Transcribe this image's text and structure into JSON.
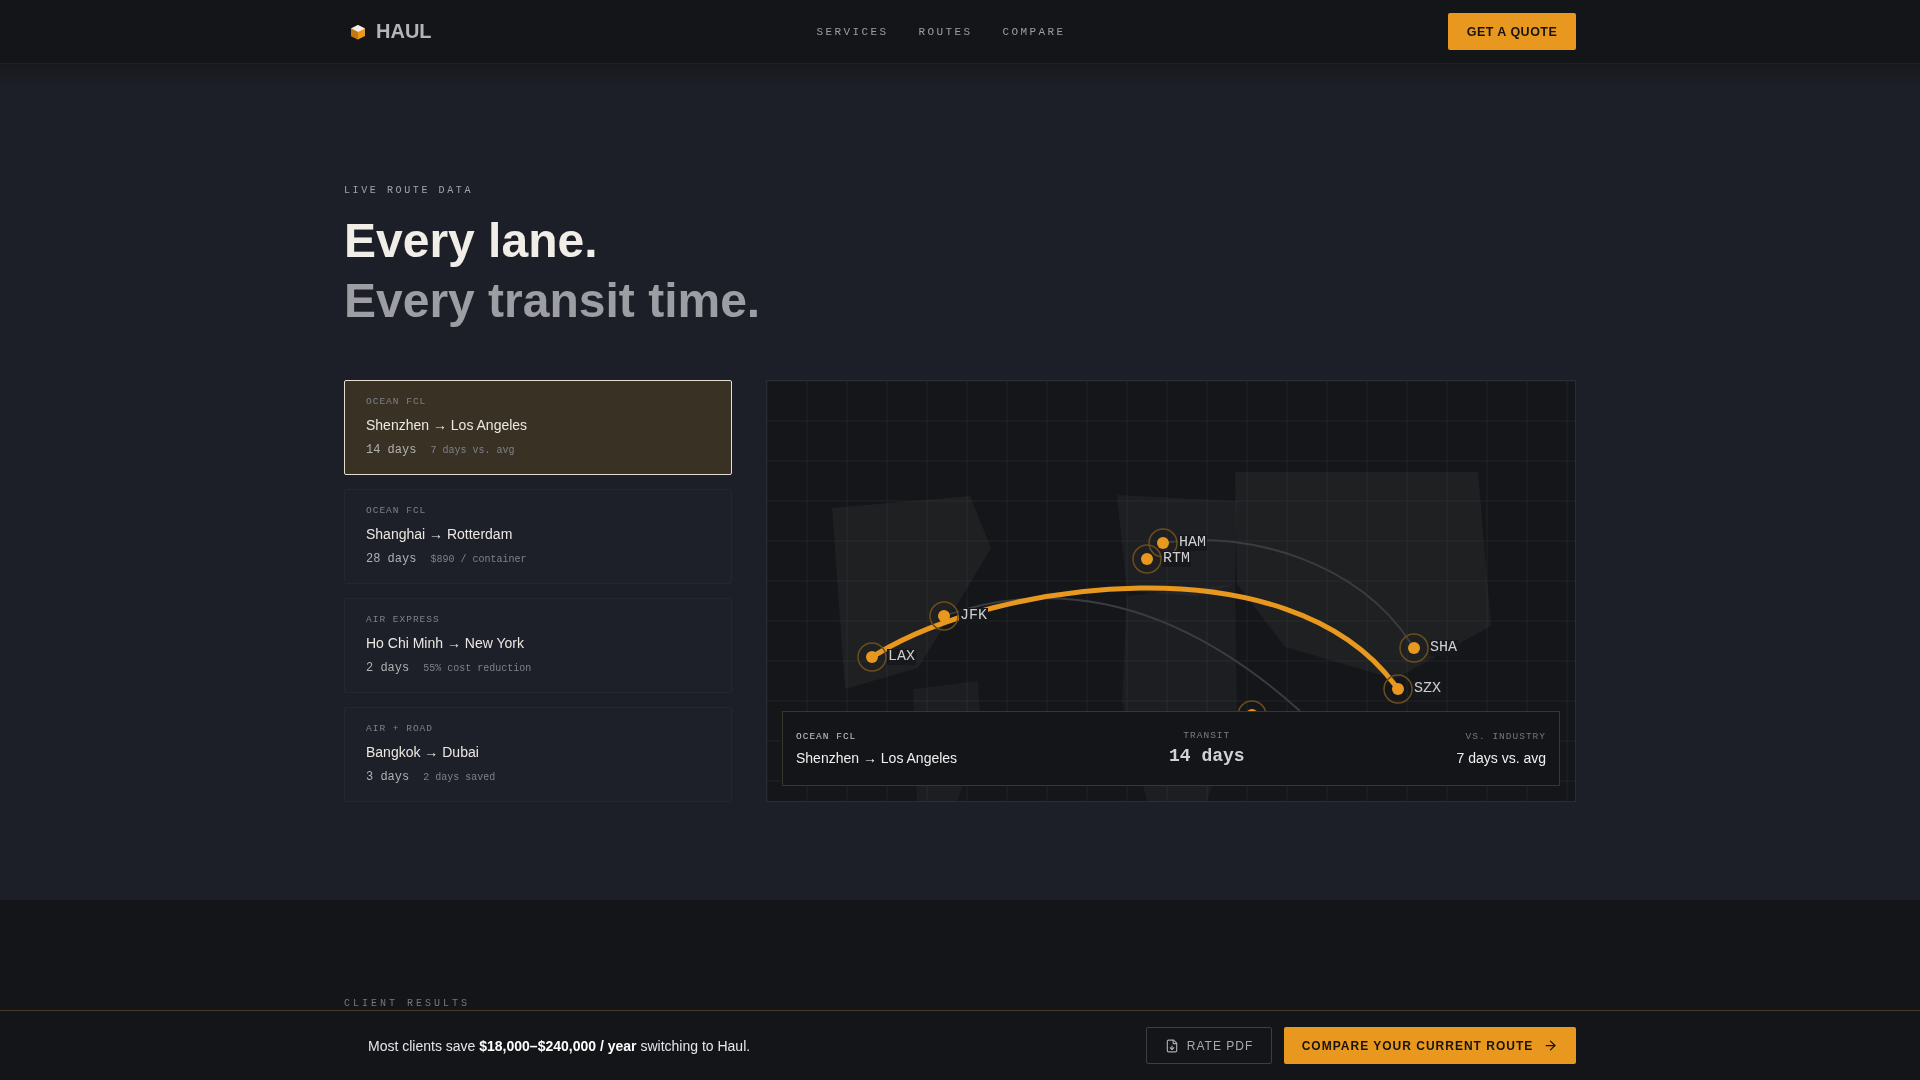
{
  "header": {
    "brand": "HAUL",
    "nav": [
      {
        "label": "SERVICES"
      },
      {
        "label": "ROUTES"
      },
      {
        "label": "COMPARE"
      }
    ],
    "cta": "GET A QUOTE"
  },
  "hero": {
    "eyebrow": "LIVE ROUTE DATA",
    "title_lines": [
      "Every lane.",
      "Every transit time."
    ]
  },
  "lanes": [
    {
      "mode": "OCEAN FCL",
      "route": "Shenzhen → Los Angeles",
      "transit": "14 days",
      "note": "7 days vs. avg",
      "selected": true
    },
    {
      "mode": "OCEAN FCL",
      "route": "Shanghai → Rotterdam",
      "transit": "28 days",
      "note": "$890 / container",
      "selected": false
    },
    {
      "mode": "AIR EXPRESS",
      "route": "Ho Chi Minh → New York",
      "transit": "2 days",
      "note": "55% cost reduction",
      "selected": false
    },
    {
      "mode": "AIR + ROAD",
      "route": "Bangkok → Dubai",
      "transit": "3 days",
      "note": "2 days saved",
      "selected": false
    }
  ],
  "map": {
    "ports": [
      {
        "code": "LAX"
      },
      {
        "code": "JFK"
      },
      {
        "code": "HAM"
      },
      {
        "code": "RTM"
      },
      {
        "code": "SHA"
      },
      {
        "code": "SZX"
      }
    ],
    "summary": {
      "mode": "OCEAN FCL",
      "route": "Shenzhen → Los Angeles",
      "transit_label": "TRANSIT",
      "transit": "14 days",
      "compare_label": "VS. INDUSTRY",
      "compare": "7 days vs. avg"
    }
  },
  "next_section": {
    "eyebrow": "CLIENT RESULTS"
  },
  "sticky_bar": {
    "message": "Most clients save **$18,000–$240,000 / year** switching to Haul.",
    "buttons": [
      {
        "label": "RATE PDF",
        "kind": "secondary"
      },
      {
        "label": "COMPARE YOUR CURRENT ROUTE",
        "kind": "primary"
      }
    ]
  }
}
